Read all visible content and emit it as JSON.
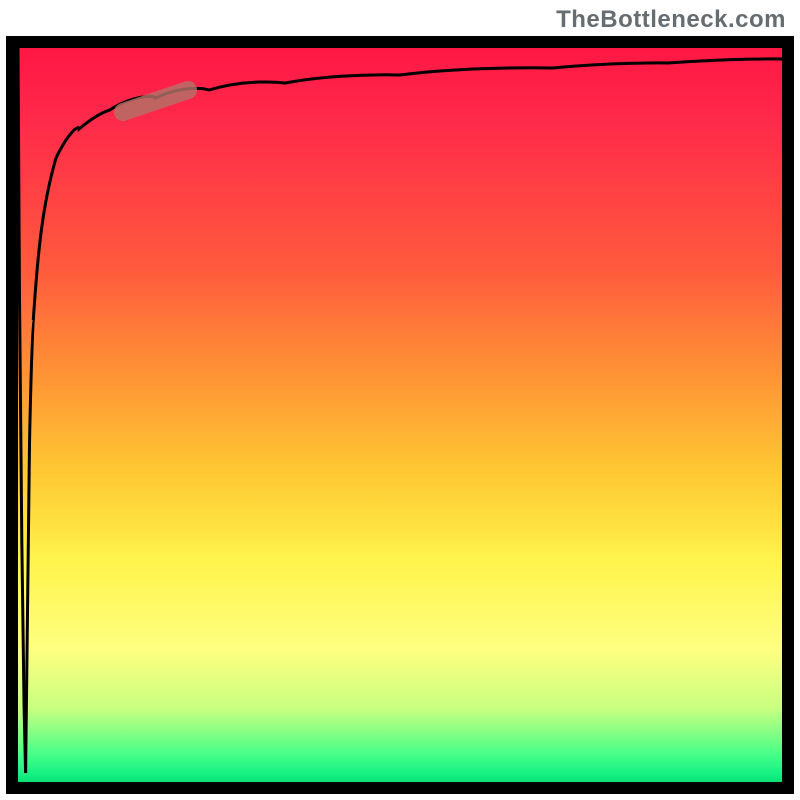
{
  "watermark": "TheBottleneck.com",
  "colors": {
    "gradient_top": "#ff1744",
    "gradient_mid_top": "#ff9534",
    "gradient_mid": "#fff44d",
    "gradient_low": "#c8ff80",
    "gradient_bottom": "#13f084",
    "curve": "#000000",
    "marker": "#b37268",
    "border": "#000000"
  },
  "chart_data": {
    "type": "line",
    "title": "",
    "xlabel": "",
    "ylabel": "",
    "xlim": [
      0,
      100
    ],
    "ylim": [
      0,
      100
    ],
    "grid": false,
    "series": [
      {
        "name": "curve-descend",
        "x": [
          0,
          0.2,
          0.5,
          0.8,
          1.0
        ],
        "values": [
          100,
          66,
          33,
          10,
          0
        ]
      },
      {
        "name": "curve-ascend",
        "x": [
          1.0,
          1.5,
          2,
          3,
          5,
          8,
          12,
          18,
          25,
          35,
          50,
          70,
          85,
          100
        ],
        "values": [
          0,
          46,
          63,
          77,
          85,
          89,
          91.5,
          93.2,
          94.3,
          95.2,
          96.3,
          97.3,
          97.9,
          98.5
        ]
      }
    ],
    "marker": {
      "x_center": 18,
      "y_center": 93,
      "length_pct": 6,
      "name": "highlight-segment"
    },
    "legend": false
  }
}
